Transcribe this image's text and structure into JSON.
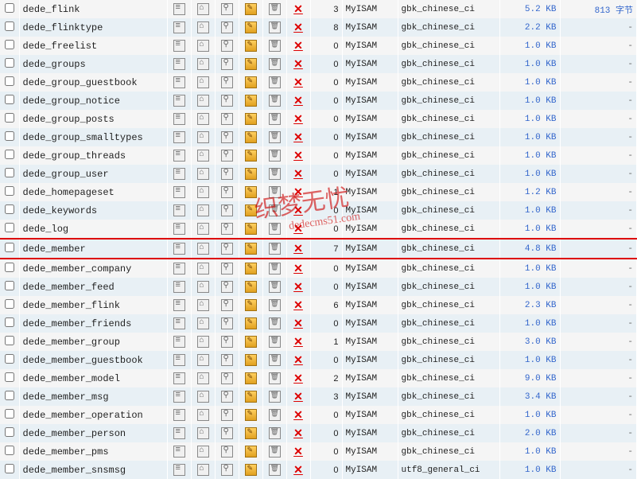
{
  "watermark": {
    "main": "织梦无忧",
    "sub": "dedecms51.com"
  },
  "highlight_index": 13,
  "tables": [
    {
      "name": "dede_flink",
      "rows": 3,
      "type": "MyISAM",
      "collation": "gbk_chinese_ci",
      "size": "5.2 KB",
      "overhead": "813 字节"
    },
    {
      "name": "dede_flinktype",
      "rows": 8,
      "type": "MyISAM",
      "collation": "gbk_chinese_ci",
      "size": "2.2 KB",
      "overhead": "-"
    },
    {
      "name": "dede_freelist",
      "rows": 0,
      "type": "MyISAM",
      "collation": "gbk_chinese_ci",
      "size": "1.0 KB",
      "overhead": "-"
    },
    {
      "name": "dede_groups",
      "rows": 0,
      "type": "MyISAM",
      "collation": "gbk_chinese_ci",
      "size": "1.0 KB",
      "overhead": "-"
    },
    {
      "name": "dede_group_guestbook",
      "rows": 0,
      "type": "MyISAM",
      "collation": "gbk_chinese_ci",
      "size": "1.0 KB",
      "overhead": "-"
    },
    {
      "name": "dede_group_notice",
      "rows": 0,
      "type": "MyISAM",
      "collation": "gbk_chinese_ci",
      "size": "1.0 KB",
      "overhead": "-"
    },
    {
      "name": "dede_group_posts",
      "rows": 0,
      "type": "MyISAM",
      "collation": "gbk_chinese_ci",
      "size": "1.0 KB",
      "overhead": "-"
    },
    {
      "name": "dede_group_smalltypes",
      "rows": 0,
      "type": "MyISAM",
      "collation": "gbk_chinese_ci",
      "size": "1.0 KB",
      "overhead": "-"
    },
    {
      "name": "dede_group_threads",
      "rows": 0,
      "type": "MyISAM",
      "collation": "gbk_chinese_ci",
      "size": "1.0 KB",
      "overhead": "-"
    },
    {
      "name": "dede_group_user",
      "rows": 0,
      "type": "MyISAM",
      "collation": "gbk_chinese_ci",
      "size": "1.0 KB",
      "overhead": "-"
    },
    {
      "name": "dede_homepageset",
      "rows": 1,
      "type": "MyISAM",
      "collation": "gbk_chinese_ci",
      "size": "1.2 KB",
      "overhead": "-"
    },
    {
      "name": "dede_keywords",
      "rows": 0,
      "type": "MyISAM",
      "collation": "gbk_chinese_ci",
      "size": "1.0 KB",
      "overhead": "-"
    },
    {
      "name": "dede_log",
      "rows": 0,
      "type": "MyISAM",
      "collation": "gbk_chinese_ci",
      "size": "1.0 KB",
      "overhead": "-"
    },
    {
      "name": "dede_member",
      "rows": 7,
      "type": "MyISAM",
      "collation": "gbk_chinese_ci",
      "size": "4.8 KB",
      "overhead": "-"
    },
    {
      "name": "dede_member_company",
      "rows": 0,
      "type": "MyISAM",
      "collation": "gbk_chinese_ci",
      "size": "1.0 KB",
      "overhead": "-"
    },
    {
      "name": "dede_member_feed",
      "rows": 0,
      "type": "MyISAM",
      "collation": "gbk_chinese_ci",
      "size": "1.0 KB",
      "overhead": "-"
    },
    {
      "name": "dede_member_flink",
      "rows": 6,
      "type": "MyISAM",
      "collation": "gbk_chinese_ci",
      "size": "2.3 KB",
      "overhead": "-"
    },
    {
      "name": "dede_member_friends",
      "rows": 0,
      "type": "MyISAM",
      "collation": "gbk_chinese_ci",
      "size": "1.0 KB",
      "overhead": "-"
    },
    {
      "name": "dede_member_group",
      "rows": 1,
      "type": "MyISAM",
      "collation": "gbk_chinese_ci",
      "size": "3.0 KB",
      "overhead": "-"
    },
    {
      "name": "dede_member_guestbook",
      "rows": 0,
      "type": "MyISAM",
      "collation": "gbk_chinese_ci",
      "size": "1.0 KB",
      "overhead": "-"
    },
    {
      "name": "dede_member_model",
      "rows": 2,
      "type": "MyISAM",
      "collation": "gbk_chinese_ci",
      "size": "9.0 KB",
      "overhead": "-"
    },
    {
      "name": "dede_member_msg",
      "rows": 3,
      "type": "MyISAM",
      "collation": "gbk_chinese_ci",
      "size": "3.4 KB",
      "overhead": "-"
    },
    {
      "name": "dede_member_operation",
      "rows": 0,
      "type": "MyISAM",
      "collation": "gbk_chinese_ci",
      "size": "1.0 KB",
      "overhead": "-"
    },
    {
      "name": "dede_member_person",
      "rows": 0,
      "type": "MyISAM",
      "collation": "gbk_chinese_ci",
      "size": "2.0 KB",
      "overhead": "-"
    },
    {
      "name": "dede_member_pms",
      "rows": 0,
      "type": "MyISAM",
      "collation": "gbk_chinese_ci",
      "size": "1.0 KB",
      "overhead": "-"
    },
    {
      "name": "dede_member_snsmsg",
      "rows": 0,
      "type": "MyISAM",
      "collation": "utf8_general_ci",
      "size": "1.0 KB",
      "overhead": "-"
    }
  ]
}
